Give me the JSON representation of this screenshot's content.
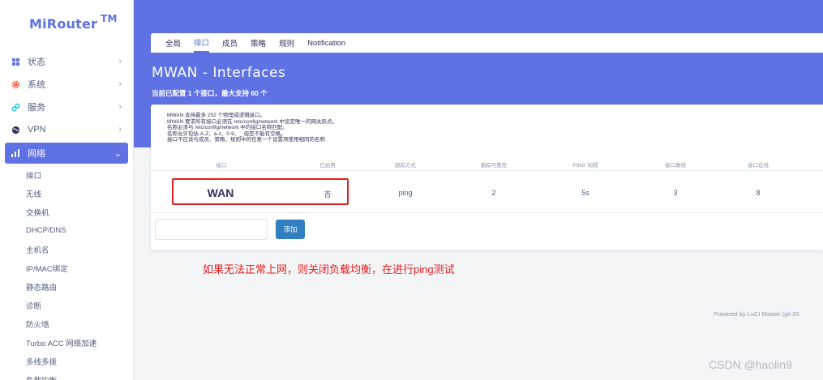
{
  "logo": {
    "name": "MiRouter",
    "tm": "TM"
  },
  "colors": {
    "accent": "#5e72e4",
    "annotation": "#e02020",
    "add_button": "#2f7fc1"
  },
  "sidebar": {
    "items": [
      {
        "label": "状态",
        "icon": "grid-icon"
      },
      {
        "label": "系统",
        "icon": "gear-icon"
      },
      {
        "label": "服务",
        "icon": "link-icon"
      },
      {
        "label": "VPN",
        "icon": "globe-icon"
      },
      {
        "label": "网络",
        "icon": "network-icon"
      }
    ],
    "submenu": [
      "接口",
      "无线",
      "交换机",
      "DHCP/DNS",
      "主机名",
      "IP/MAC绑定",
      "静态路由",
      "诊断",
      "防火墙",
      "Turbo ACC 网络加速",
      "多线多拨",
      "负载均衡"
    ]
  },
  "tabs": [
    "全局",
    "接口",
    "成员",
    "策略",
    "规则",
    "Notification"
  ],
  "page": {
    "title": "MWAN - Interfaces",
    "subtitle": "当前已配置 1 个接口，最大支持 60 个"
  },
  "notes": [
    "MWAN 支持最多 252 个物理或逻辑接口。",
    "MWAN 要求所有接口必须在 /etc/config/network 中设定唯一的网关跃点。",
    "名称必须与 /etc/config/network 中的接口名称匹配。",
    "名称允许包括 A-Z、a-z、0-9、_ 但是不能有空格。",
    "接口不应该与成员、策略、规则中的任意一个设置项使用相同的名称"
  ],
  "table": {
    "headers": [
      "接口",
      "已启用",
      "跟踪方式",
      "跟踪可靠性",
      "PING 间隔",
      "接口离线",
      "接口在线"
    ],
    "rows": [
      [
        "WAN",
        "否",
        "ping",
        "2",
        "5s",
        "3",
        "8"
      ]
    ]
  },
  "add_button": "添加",
  "annotation": "如果无法正常上网，则关闭负载均衡，在进行ping测试",
  "footer": "Powered by LuCI Master (git 20.",
  "watermark": "CSDN @haolin9"
}
